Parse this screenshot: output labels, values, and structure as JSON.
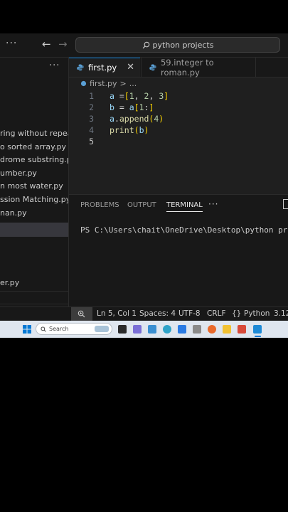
{
  "titlebar": {
    "more": "···",
    "back": "←",
    "forward": "→",
    "search_text": "python projects"
  },
  "sidebar": {
    "more": "···",
    "files": [
      "ring without repea...",
      "o sorted array.py",
      "drome substring.py",
      "umber.py",
      "n most water.py",
      "ssion Matching.py",
      "nan.py",
      "er.py"
    ]
  },
  "tabs": [
    {
      "label": "first.py",
      "close": "✕"
    },
    {
      "label": "59.integer to roman.py"
    }
  ],
  "breadcrumb": {
    "file": "first.py",
    "sep": ">",
    "rest": "..."
  },
  "editor": {
    "line_numbers": [
      "1",
      "2",
      "3",
      "4",
      "5"
    ],
    "lines": [
      {
        "a": "a",
        "b": " =",
        "c": "[",
        "d": "1",
        "e": ", ",
        "f": "2",
        "g": ", ",
        "h": "3",
        "i": "]"
      },
      {
        "a": "b",
        "b": " = ",
        "c": "a",
        "d": "[",
        "e": "1",
        "f": ":",
        "g": "]"
      },
      {
        "a": "a",
        "b": ".",
        "c": "append",
        "d": "(",
        "e": "4",
        "f": ")"
      },
      {
        "a": "print",
        "b": "(",
        "c": "b",
        "d": ")"
      }
    ]
  },
  "panel": {
    "tabs": [
      "PROBLEMS",
      "OUTPUT",
      "TERMINAL"
    ],
    "more": "···",
    "terminal_text": "PS C:\\Users\\chait\\OneDrive\\Desktop\\python proje"
  },
  "statusbar": {
    "position": "Ln 5, Col 1",
    "spaces": "Spaces: 4",
    "encoding": "UTF-8",
    "eol": "CRLF",
    "braces": "{}",
    "language": "Python",
    "version": "3.12"
  },
  "taskbar": {
    "search_placeholder": "Search"
  },
  "colors": {
    "accent": "#0078d4",
    "editor_bg": "#1f1f1f",
    "sidebar_bg": "#181818"
  }
}
